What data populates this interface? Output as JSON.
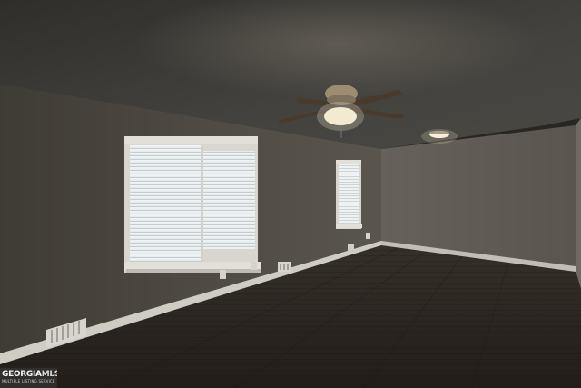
{
  "image": {
    "watermark": {
      "brand": "GEORGIA",
      "suffix": "MLS",
      "tagline": "MULTIPLE LISTING SERVICE"
    },
    "colors": {
      "ceiling": "#3f3d39",
      "wall_left": "#4f4a43",
      "wall_back": "#5f5a52",
      "floor": "#2d2722",
      "baseboard": "#cfccc4",
      "window_light": "#e9eef0",
      "ceiling_light": "#f4ead2"
    },
    "icons": [
      "ceiling-fan-icon",
      "light-fixture-icon",
      "vent-icon",
      "outlet-icon"
    ]
  }
}
